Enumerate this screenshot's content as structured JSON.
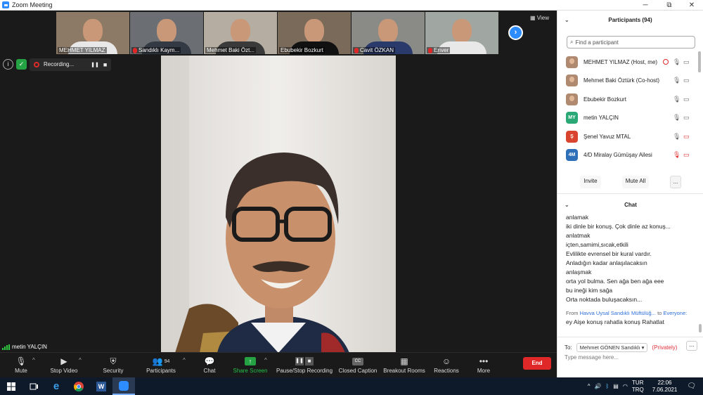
{
  "window": {
    "title": "Zoom Meeting",
    "minimize": "─",
    "restore": "⧉",
    "maximize": "☐",
    "close": "✕"
  },
  "gallery": {
    "view_label": "View",
    "thumbnails": [
      {
        "name": "MEHMET YILMAZ",
        "muted": false,
        "shirt": "#e8e8e8",
        "bg": "#8d7a66"
      },
      {
        "name": "Sandıklı Kaym...",
        "muted": true,
        "shirt": "#333a44",
        "bg": "#6b6e72"
      },
      {
        "name": "Mehmet Baki Özt...",
        "muted": false,
        "shirt": "#3a3a3a",
        "bg": "#b5ada2"
      },
      {
        "name": "Ebubekir Bozkurt",
        "muted": false,
        "shirt": "#111",
        "bg": "#7a6a5a"
      },
      {
        "name": "Cavit ÖZKAN",
        "muted": true,
        "shirt": "#2a3a6a",
        "bg": "#8a8a86"
      },
      {
        "name": "Erıver",
        "muted": true,
        "shirt": "#e8e8e8",
        "bg": "#a0a7a2"
      }
    ]
  },
  "recording": {
    "label": "Recording...",
    "pause": "❚❚",
    "stop": "■"
  },
  "active_speaker": {
    "name": "metin YALÇIN"
  },
  "toolbar": {
    "mute": "Mute",
    "stop_video": "Stop Video",
    "security": "Security",
    "participants": "Participants",
    "participants_count": "94",
    "chat": "Chat",
    "share_screen": "Share Screen",
    "pause_stop_recording": "Pause/Stop Recording",
    "closed_caption": "Closed Caption",
    "breakout_rooms": "Breakout Rooms",
    "reactions": "Reactions",
    "more": "More",
    "end": "End",
    "caret": "^"
  },
  "participants_panel": {
    "title": "Participants (94)",
    "search_placeholder": "Find a participant",
    "rows": [
      {
        "name": "MEHMET YILMAZ (Host, me)",
        "avatar": "",
        "color": "",
        "recording": true,
        "mic_muted": false,
        "cam_off": false
      },
      {
        "name": "Mehmet Baki Öztürk (Co-host)",
        "avatar": "",
        "color": "",
        "recording": false,
        "mic_muted": false,
        "cam_off": false
      },
      {
        "name": "Ebubekir Bozkurt",
        "avatar": "",
        "color": "",
        "recording": false,
        "mic_muted": false,
        "cam_off": false
      },
      {
        "name": "metin YALÇIN",
        "avatar": "MY",
        "color": "#2aa876",
        "recording": false,
        "mic_muted": false,
        "cam_off": false
      },
      {
        "name": "Şenel Yavuz MTAL",
        "avatar": "Ş",
        "color": "#d9442e",
        "recording": false,
        "mic_muted": false,
        "cam_off": true
      },
      {
        "name": "4/D Miralay Gümüşay Ailesi",
        "avatar": "4M",
        "color": "#2d6fb8",
        "recording": false,
        "mic_muted": true,
        "cam_off": true
      }
    ],
    "invite": "Invite",
    "mute_all": "Mute All",
    "more": "..."
  },
  "chat_panel": {
    "title": "Chat",
    "messages": [
      "anlamak",
      "iki dinle bir konuş. Çok dinle az konuş...",
      "anlatmak",
      "içten,samimi,sıcak,etkili",
      "Evlilikte evrensel bir kural vardır.",
      "Anladığın kadar anlaşılacaksın",
      "anlaşmak",
      "orta yol bulma. Sen ağa ben ağa eee",
      "bu ineği kim sağa",
      "Orta noktada buluşacaksın..."
    ],
    "last_from_prefix": "From",
    "last_from_name": "Havva Uysal Sandıklı Müftülüğ...",
    "last_to_prefix": "to",
    "last_to_name": "Everyone:",
    "last_message": "ey Aişe konuş rahatla konuş Rahatlat",
    "to_label": "To:",
    "recipient": "Mehmet GÖNEN Sandıklı",
    "privately": "(Privately)",
    "more": "...",
    "input_placeholder": "Type message here..."
  },
  "taskbar": {
    "lang": "TUR",
    "lang_sub": "TRQ",
    "time": "22:06",
    "date": "7.06.2021"
  }
}
